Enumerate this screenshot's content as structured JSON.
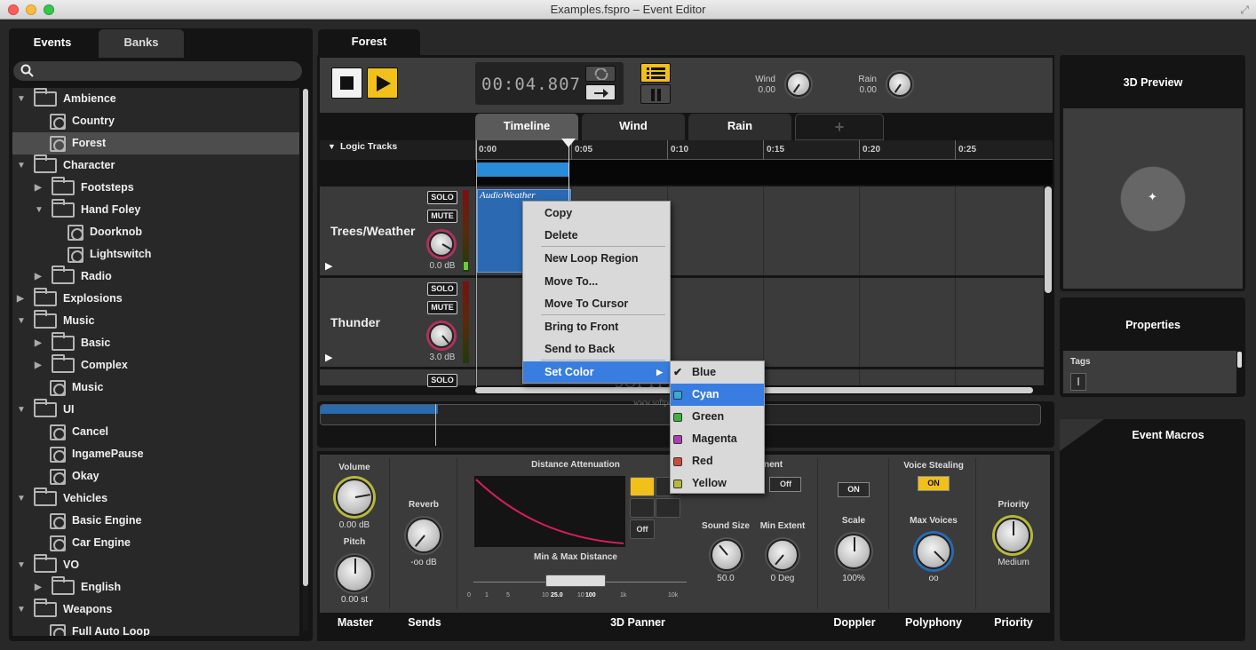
{
  "window": {
    "title": "Examples.fspro – Event Editor"
  },
  "left_panel": {
    "tabs": [
      {
        "label": "Events"
      },
      {
        "label": "Banks"
      }
    ],
    "tree": [
      {
        "label": "Ambience",
        "type": "folder",
        "level": 0,
        "expanded": true
      },
      {
        "label": "Country",
        "type": "event",
        "level": 1
      },
      {
        "label": "Forest",
        "type": "event",
        "level": 1,
        "selected": true
      },
      {
        "label": "Character",
        "type": "folder",
        "level": 0,
        "expanded": true
      },
      {
        "label": "Footsteps",
        "type": "folder",
        "level": 1,
        "expanded": false
      },
      {
        "label": "Hand Foley",
        "type": "folder",
        "level": 1,
        "expanded": true
      },
      {
        "label": "Doorknob",
        "type": "event",
        "level": 2
      },
      {
        "label": "Lightswitch",
        "type": "event",
        "level": 2
      },
      {
        "label": "Radio",
        "type": "folder",
        "level": 1,
        "expanded": false
      },
      {
        "label": "Explosions",
        "type": "folder",
        "level": 0,
        "expanded": false
      },
      {
        "label": "Music",
        "type": "folder",
        "level": 0,
        "expanded": true
      },
      {
        "label": "Basic",
        "type": "folder",
        "level": 1,
        "expanded": false
      },
      {
        "label": "Complex",
        "type": "folder",
        "level": 1,
        "expanded": false
      },
      {
        "label": "Music",
        "type": "event",
        "level": 1
      },
      {
        "label": "UI",
        "type": "folder",
        "level": 0,
        "expanded": true
      },
      {
        "label": "Cancel",
        "type": "event",
        "level": 1
      },
      {
        "label": "IngamePause",
        "type": "event",
        "level": 1
      },
      {
        "label": "Okay",
        "type": "event",
        "level": 1
      },
      {
        "label": "Vehicles",
        "type": "folder",
        "level": 0,
        "expanded": true
      },
      {
        "label": "Basic Engine",
        "type": "event",
        "level": 1
      },
      {
        "label": "Car Engine",
        "type": "event",
        "level": 1
      },
      {
        "label": "VO",
        "type": "folder",
        "level": 0,
        "expanded": true
      },
      {
        "label": "English",
        "type": "folder",
        "level": 1,
        "expanded": false
      },
      {
        "label": "Weapons",
        "type": "folder",
        "level": 0,
        "expanded": true
      },
      {
        "label": "Full Auto Loop",
        "type": "event",
        "level": 1
      }
    ]
  },
  "editor": {
    "event_tab": "Forest",
    "time": "00:04.807",
    "params": [
      {
        "name": "Wind",
        "value": "0.00"
      },
      {
        "name": "Rain",
        "value": "0.00"
      }
    ],
    "tabs": [
      {
        "label": "Timeline"
      },
      {
        "label": "Wind"
      },
      {
        "label": "Rain"
      },
      {
        "label": "+"
      }
    ],
    "logic_tracks_label": "Logic Tracks",
    "ruler": [
      "0:00",
      "0:05",
      "0:10",
      "0:15",
      "0:20",
      "0:25"
    ],
    "tracks": [
      {
        "name": "Trees/Weather",
        "gain": "0.0 dB",
        "solo": "SOLO",
        "mute": "MUTE"
      },
      {
        "name": "Thunder",
        "gain": "3.0 dB",
        "solo": "SOLO",
        "mute": "MUTE"
      },
      {
        "solo": "SOLO"
      }
    ],
    "region_label": "AudioWeather"
  },
  "context_menu": {
    "items": [
      {
        "label": "Copy"
      },
      {
        "label": "Delete"
      },
      {
        "label": "New Loop Region"
      },
      {
        "label": "Move To..."
      },
      {
        "label": "Move To Cursor"
      },
      {
        "label": "Bring to Front"
      },
      {
        "label": "Send to Back"
      },
      {
        "label": "Set Color"
      }
    ],
    "submenu": [
      {
        "label": "Blue",
        "color": "#2f64c8",
        "checked": true
      },
      {
        "label": "Cyan",
        "color": "#3aa8d8"
      },
      {
        "label": "Green",
        "color": "#3fb03f"
      },
      {
        "label": "Magenta",
        "color": "#b03ab0"
      },
      {
        "label": "Red",
        "color": "#d04a3a"
      },
      {
        "label": "Yellow",
        "color": "#b8b83a"
      }
    ]
  },
  "deck": {
    "volume_label": "Volume",
    "volume_value": "0.00 dB",
    "pitch_label": "Pitch",
    "pitch_value": "0.00 st",
    "reverb_label": "Reverb",
    "reverb_value": "-oo dB",
    "distance_label": "Distance Attenuation",
    "curve_off": "Off",
    "minmax_label": "Min & Max Distance",
    "scale_ticks": [
      "0",
      "1",
      "5",
      "10",
      "25.0",
      "10",
      "100",
      "1k",
      "10k"
    ],
    "partial_label": "nent",
    "partial_off": "Off",
    "sound_size_label": "Sound Size",
    "sound_size_value": "50.0",
    "min_extent_label": "Min Extent",
    "min_extent_value": "0 Deg",
    "doppler_on": "ON",
    "scale_label": "Scale",
    "scale_value": "100%",
    "voice_stealing_label": "Voice Stealing",
    "voice_stealing_on": "ON",
    "max_voices_label": "Max Voices",
    "max_voices_value": "oo",
    "priority_label": "Priority",
    "priority_value": "Medium",
    "footer": [
      "Master",
      "Sends",
      "3D Panner",
      "Doppler",
      "Polyphony",
      "Priority"
    ]
  },
  "right_panel": {
    "preview_title": "3D Preview",
    "properties_title": "Properties",
    "tags_label": "Tags",
    "macros_title": "Event Macros"
  },
  "watermark": {
    "main": "SOFTPEDIA",
    "sub": "www.softpedia.com"
  }
}
